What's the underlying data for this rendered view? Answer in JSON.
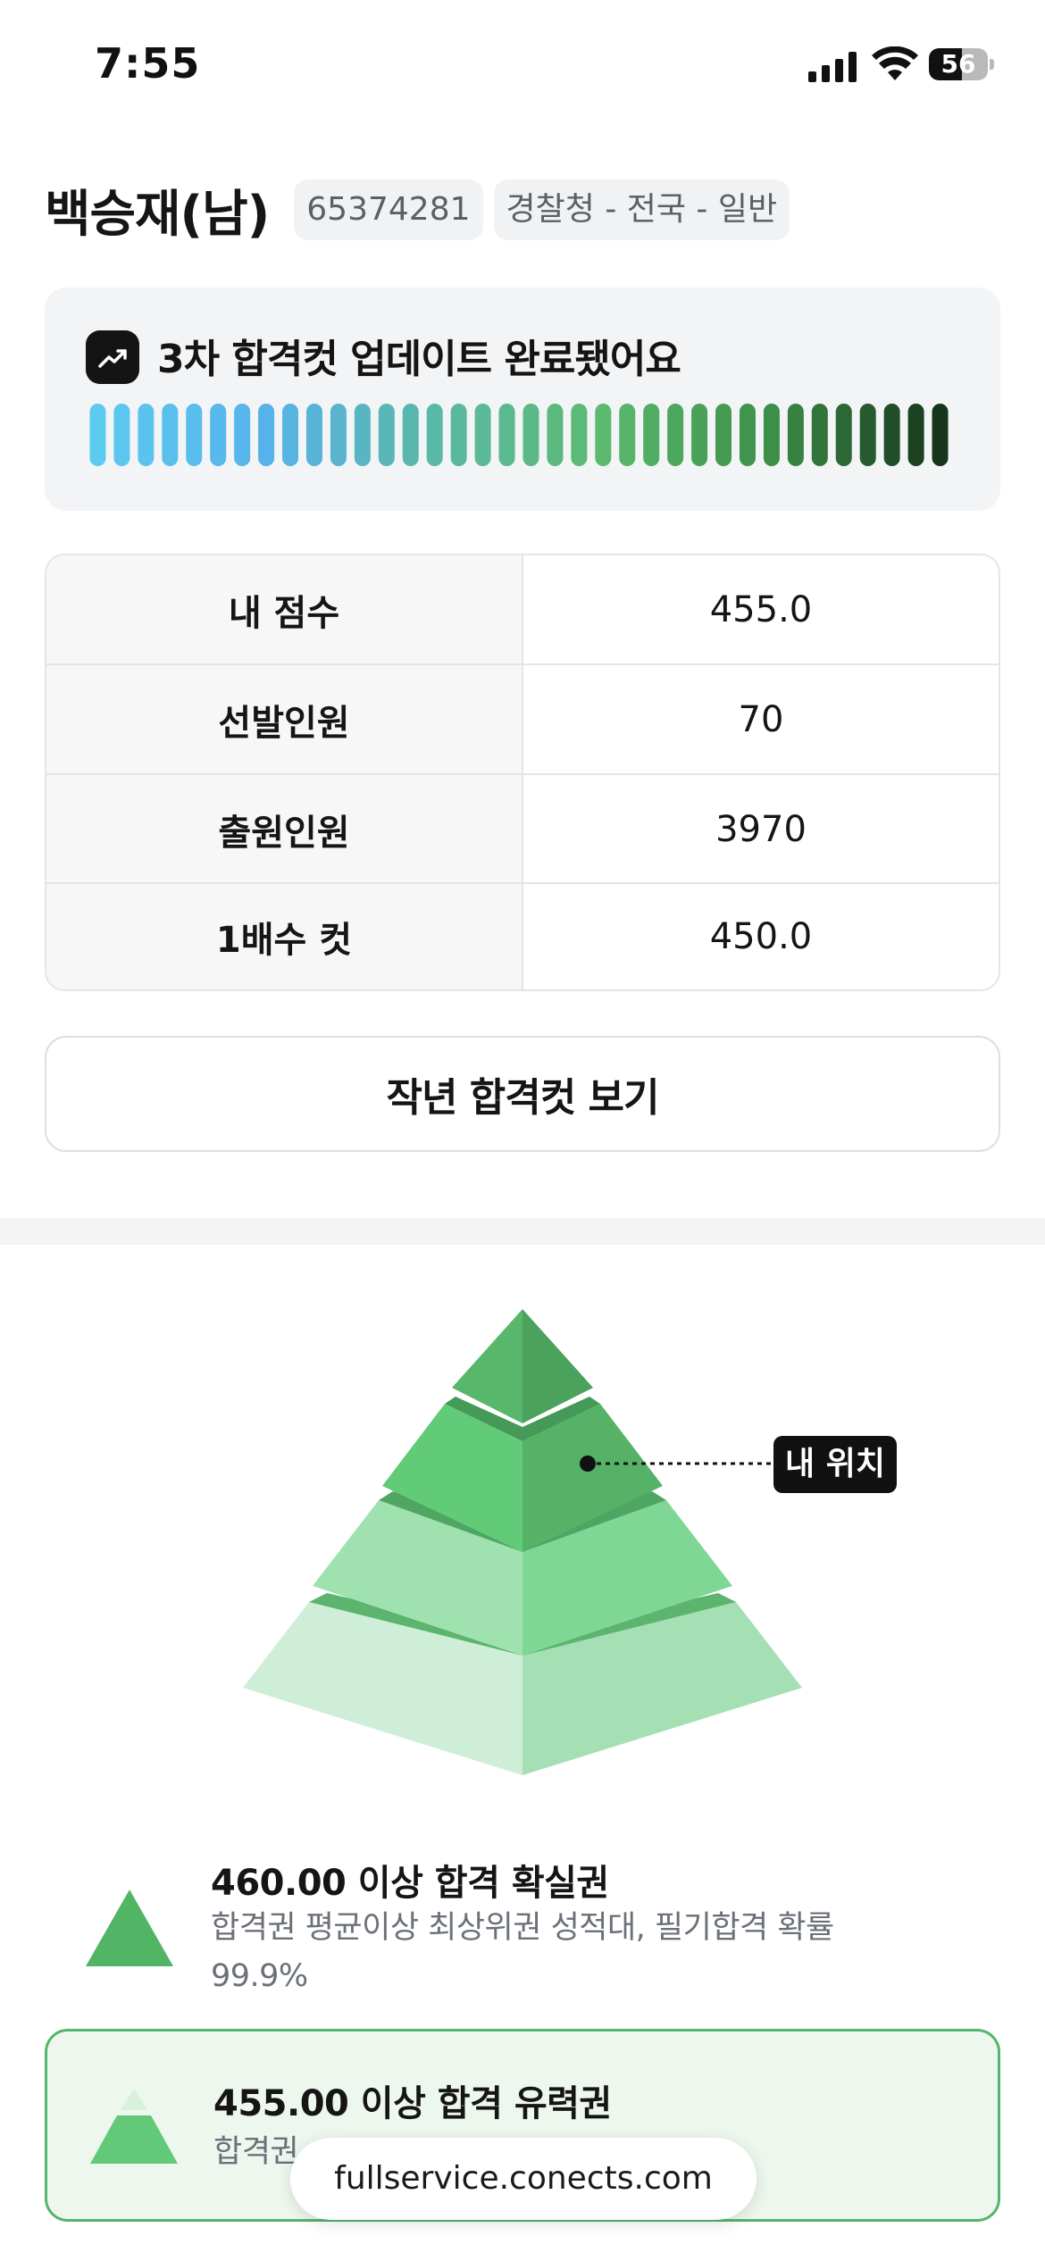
{
  "status_bar": {
    "time": "7:55",
    "battery": "56",
    "battery_level": 0.56
  },
  "header": {
    "name": "백승재(남)",
    "exam_id": "65374281",
    "exam_category": "경찰청 - 전국 - 일반"
  },
  "update_card": {
    "icon": "trending-up-icon",
    "title": "3차 합격컷 업데이트 완료됐어요",
    "gradient_colors": [
      "#5ccbf0",
      "#56b2ea",
      "#5ab8a6",
      "#5bba6f",
      "#3d8e48",
      "#16351c"
    ]
  },
  "score_table": {
    "rows": [
      {
        "label": "내 점수",
        "value": "455.0"
      },
      {
        "label": "선발인원",
        "value": "70"
      },
      {
        "label": "출원인원",
        "value": "3970"
      },
      {
        "label": "1배수 컷",
        "value": "450.0"
      }
    ]
  },
  "prev_cut_button": "작년 합격컷 보기",
  "pyramid": {
    "my_position_label": "내 위치",
    "colors": {
      "top": "#4fae62",
      "second": "#62c978",
      "third": "#9fe1af",
      "base": "#cfecd6"
    }
  },
  "tiers": [
    {
      "title": "460.00 이상 합격 확실권",
      "description": "합격권 평균이상 최상위권 성적대, 필기합격 확률 99.9%",
      "icon": "pyramid-top-icon"
    },
    {
      "title": "455.00 이상 합격 유력권",
      "description": "합격권",
      "icon": "pyramid-second-icon"
    }
  ],
  "browser": {
    "url": "fullservice.conects.com"
  }
}
